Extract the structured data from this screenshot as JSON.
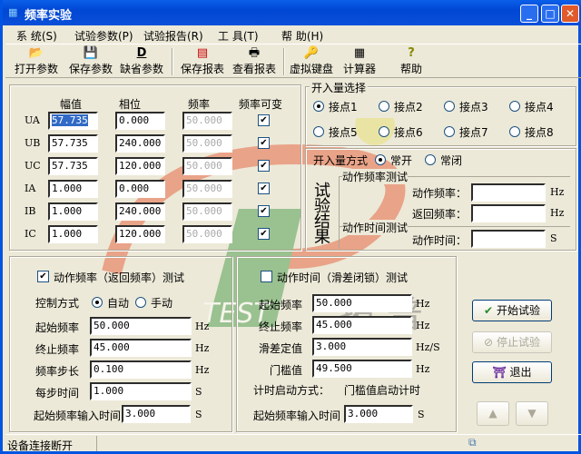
{
  "window": {
    "title": "频率实验",
    "controls": [
      "minimize",
      "maximize",
      "close"
    ]
  },
  "menu": [
    "系 统(S)",
    "试验参数(P)",
    "试验报告(R)",
    "工 具(T)",
    "帮 助(H)"
  ],
  "toolbar": [
    {
      "label": "打开参数",
      "icon": "folder-open-icon",
      "glyph": "📂"
    },
    {
      "label": "保存参数",
      "icon": "floppy-disk-icon",
      "glyph": "💾"
    },
    {
      "label": "缺省参数",
      "icon": "default-params-icon",
      "glyph": "D"
    },
    {
      "label": "保存报表",
      "icon": "excel-report-icon",
      "glyph": "▤"
    },
    {
      "label": "查看报表",
      "icon": "printer-icon",
      "glyph": "🖶"
    },
    {
      "label": "虚拟键盘",
      "icon": "key-icon",
      "glyph": "🔑"
    },
    {
      "label": "计算器",
      "icon": "calculator-icon",
      "glyph": "▦"
    },
    {
      "label": "帮助",
      "icon": "question-icon",
      "glyph": "?"
    }
  ],
  "channels": {
    "headers": [
      "幅值",
      "相位",
      "频率",
      "频率可变"
    ],
    "rows": [
      {
        "name": "UA",
        "amp": "57.735",
        "phase": "0.000",
        "freq": "50.000",
        "variable": true
      },
      {
        "name": "UB",
        "amp": "57.735",
        "phase": "240.000",
        "freq": "50.000",
        "variable": true
      },
      {
        "name": "UC",
        "amp": "57.735",
        "phase": "120.000",
        "freq": "50.000",
        "variable": true
      },
      {
        "name": "IA",
        "amp": "1.000",
        "phase": "0.000",
        "freq": "50.000",
        "variable": true
      },
      {
        "name": "IB",
        "amp": "1.000",
        "phase": "240.000",
        "freq": "50.000",
        "variable": true
      },
      {
        "name": "IC",
        "amp": "1.000",
        "phase": "120.000",
        "freq": "50.000",
        "variable": true
      }
    ]
  },
  "binary_input": {
    "title": "开入量选择",
    "options": [
      "接点1",
      "接点2",
      "接点3",
      "接点4",
      "接点5",
      "接点6",
      "接点7",
      "接点8"
    ],
    "selected": 0
  },
  "binary_mode": {
    "label": "开入量方式",
    "options": [
      "常开",
      "常闭"
    ],
    "selected": 0
  },
  "results": {
    "title": "试验结果",
    "title_chars": [
      "试",
      "验",
      "结",
      "果"
    ],
    "freq_test": "动作频率测试",
    "time_test": "动作时间测试",
    "action_freq": {
      "label": "动作频率：",
      "value": "",
      "unit": "Hz"
    },
    "return_freq": {
      "label": "返回频率：",
      "value": "",
      "unit": "Hz"
    },
    "action_time": {
      "label": "动作时间：",
      "value": "",
      "unit": "S"
    }
  },
  "freq_test": {
    "title": "动作频率（返回频率）测试",
    "checked": true,
    "control_label": "控制方式",
    "control_options": [
      "自动",
      "手动"
    ],
    "control_selected": 0,
    "fields": [
      {
        "label": "起始频率",
        "value": "50.000",
        "unit": "Hz"
      },
      {
        "label": "终止频率",
        "value": "45.000",
        "unit": "Hz"
      },
      {
        "label": "频率步长",
        "value": "0.100",
        "unit": "Hz"
      },
      {
        "label": "每步时间",
        "value": "1.000",
        "unit": "S"
      }
    ],
    "start_input_time": {
      "label": "起始频率输入时间",
      "value": "3.000",
      "unit": "S"
    }
  },
  "time_test": {
    "title": "动作时间（滑差闭锁）测试",
    "checked": false,
    "fields": [
      {
        "label": "起始频率",
        "value": "50.000",
        "unit": "Hz"
      },
      {
        "label": "终止频率",
        "value": "45.000",
        "unit": "Hz"
      },
      {
        "label": "滑差定值",
        "value": "3.000",
        "unit": "Hz/S"
      },
      {
        "label": "门槛值",
        "value": "49.500",
        "unit": "Hz"
      }
    ],
    "timer_start_label": "计时启动方式：",
    "timer_start_value": "门槛值启动计时",
    "start_input_time": {
      "label": "起始频率输入时间",
      "value": "3.000",
      "unit": "S"
    }
  },
  "actions": {
    "start": "开始试验",
    "stop": "停止试验",
    "exit": "退出"
  },
  "watermark": {
    "text": "TEST",
    "cn": "拓 普"
  },
  "status": {
    "text": "设备连接断开"
  },
  "colors": {
    "titlebar": "#0054e3",
    "face": "#ece9d8",
    "selection": "#316ac5"
  }
}
